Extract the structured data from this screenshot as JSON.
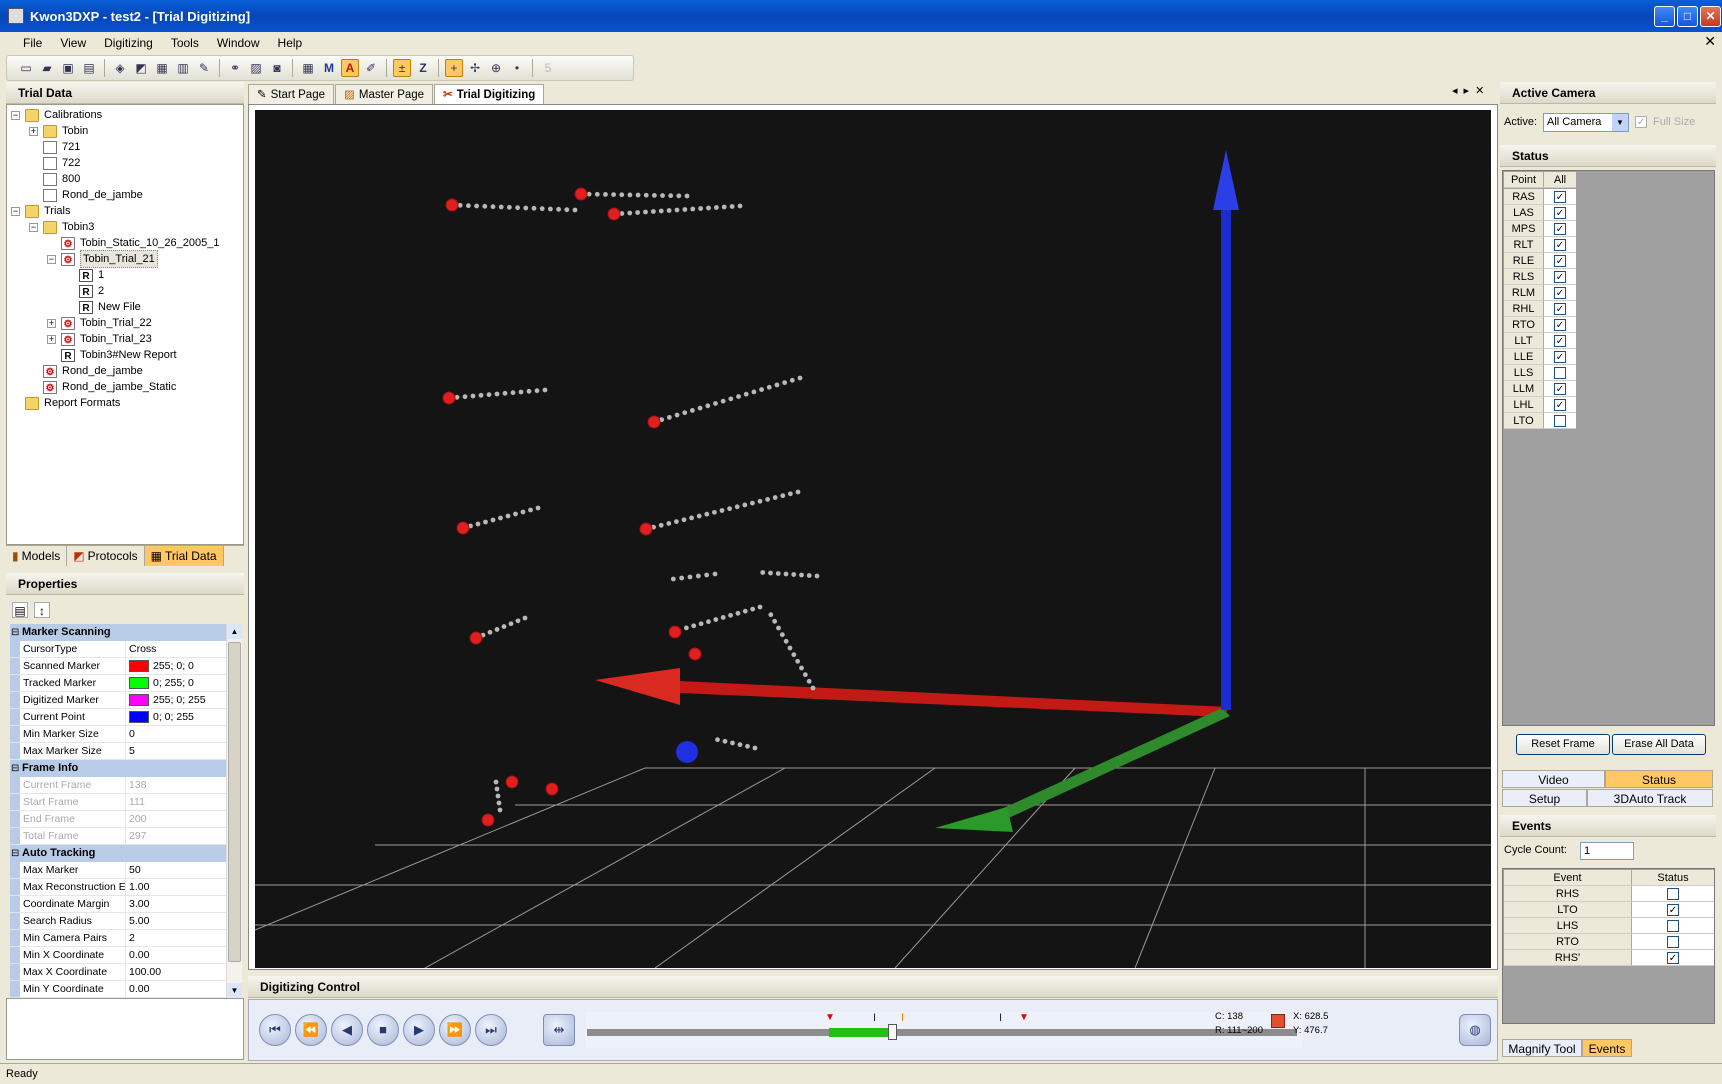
{
  "window": {
    "title": "Kwon3DXP - test2 - [Trial Digitizing]",
    "min": "_",
    "max": "□",
    "close": "✕",
    "mdi_close": "✕"
  },
  "menu": [
    "File",
    "View",
    "Digitizing",
    "Tools",
    "Window",
    "Help"
  ],
  "trial_panel": {
    "title": "Trial Data",
    "tree": [
      {
        "label": "Calibrations",
        "icon": "folder",
        "depth": 0,
        "exp": "−"
      },
      {
        "label": "Tobin",
        "icon": "folder",
        "depth": 1,
        "exp": "+"
      },
      {
        "label": "721",
        "icon": "file",
        "depth": 1
      },
      {
        "label": "722",
        "icon": "file",
        "depth": 1
      },
      {
        "label": "800",
        "icon": "file",
        "depth": 1
      },
      {
        "label": "Rond_de_jambe",
        "icon": "file",
        "depth": 1
      },
      {
        "label": "Trials",
        "icon": "folder",
        "depth": 0,
        "exp": "−"
      },
      {
        "label": "Tobin3",
        "icon": "folder",
        "depth": 1,
        "exp": "−"
      },
      {
        "label": "Tobin_Static_10_26_2005_1",
        "icon": "trial",
        "depth": 2
      },
      {
        "label": "Tobin_Trial_21",
        "icon": "trial",
        "depth": 2,
        "exp": "−",
        "selected": true
      },
      {
        "label": "1",
        "icon": "report",
        "depth": 3
      },
      {
        "label": "2",
        "icon": "report",
        "depth": 3
      },
      {
        "label": "New File",
        "icon": "report",
        "depth": 3
      },
      {
        "label": "Tobin_Trial_22",
        "icon": "trial",
        "depth": 2,
        "exp": "+"
      },
      {
        "label": "Tobin_Trial_23",
        "icon": "trial",
        "depth": 2,
        "exp": "+"
      },
      {
        "label": "Tobin3#New Report",
        "icon": "report",
        "depth": 2
      },
      {
        "label": "Rond_de_jambe",
        "icon": "trial",
        "depth": 1
      },
      {
        "label": "Rond_de_jambe_Static",
        "icon": "trial",
        "depth": 1
      },
      {
        "label": "Report Formats",
        "icon": "folder",
        "depth": 0
      }
    ]
  },
  "left_tabs": [
    "Models",
    "Protocols",
    "Trial Data"
  ],
  "properties": {
    "title": "Properties",
    "categories": [
      {
        "name": "Marker Scanning",
        "rows": [
          {
            "name": "CursorType",
            "value": "Cross"
          },
          {
            "name": "Scanned Marker",
            "value": "255; 0; 0",
            "color": "#ff0000"
          },
          {
            "name": "Tracked Marker",
            "value": "0; 255; 0",
            "color": "#00ff00"
          },
          {
            "name": "Digitized Marker",
            "value": "255; 0; 255",
            "color": "#ff00ff"
          },
          {
            "name": "Current Point",
            "value": "0; 0; 255",
            "color": "#0000ff"
          },
          {
            "name": "Min Marker Size",
            "value": "0"
          },
          {
            "name": "Max Marker Size",
            "value": "5"
          }
        ]
      },
      {
        "name": "Frame Info",
        "rows": [
          {
            "name": "Current Frame",
            "value": "138",
            "dim": true
          },
          {
            "name": "Start Frame",
            "value": "111",
            "dim": true
          },
          {
            "name": "End Frame",
            "value": "200",
            "dim": true
          },
          {
            "name": "Total Frame",
            "value": "297",
            "dim": true
          }
        ]
      },
      {
        "name": "Auto Tracking",
        "rows": [
          {
            "name": "Max Marker",
            "value": "50"
          },
          {
            "name": "Max Reconstruction E",
            "value": "1.00"
          },
          {
            "name": "Coordinate Margin",
            "value": "3.00"
          },
          {
            "name": "Search Radius",
            "value": "5.00"
          },
          {
            "name": "Min Camera Pairs",
            "value": "2"
          },
          {
            "name": "Min X Coordinate",
            "value": "0.00"
          },
          {
            "name": "Max X Coordinate",
            "value": "100.00"
          },
          {
            "name": "Min Y Coordinate",
            "value": "0.00"
          }
        ]
      }
    ]
  },
  "doc_tabs": [
    {
      "label": "Start Page",
      "active": false
    },
    {
      "label": "Master Page",
      "active": false
    },
    {
      "label": "Trial Digitizing",
      "active": true
    }
  ],
  "digitizing_control": {
    "title": "Digitizing Control",
    "readout": {
      "c": "C: 138",
      "r": "R: 111~200",
      "x": "X: 628.5",
      "y": "Y: 476.7"
    }
  },
  "active_camera": {
    "title": "Active Camera",
    "label": "Active:",
    "value": "All Camera",
    "full_size": "Full Size"
  },
  "status": {
    "title": "Status",
    "headers": [
      "Point",
      "All"
    ],
    "points": [
      {
        "name": "RAS",
        "checked": true
      },
      {
        "name": "LAS",
        "checked": true
      },
      {
        "name": "MPS",
        "checked": true
      },
      {
        "name": "RLT",
        "checked": true
      },
      {
        "name": "RLE",
        "checked": true
      },
      {
        "name": "RLS",
        "checked": true
      },
      {
        "name": "RLM",
        "checked": true
      },
      {
        "name": "RHL",
        "checked": true
      },
      {
        "name": "RTO",
        "checked": true
      },
      {
        "name": "LLT",
        "checked": true
      },
      {
        "name": "LLE",
        "checked": true
      },
      {
        "name": "LLS",
        "checked": false
      },
      {
        "name": "LLM",
        "checked": true
      },
      {
        "name": "LHL",
        "checked": true
      },
      {
        "name": "LTO",
        "checked": false
      }
    ],
    "reset_frame": "Reset Frame",
    "erase_all": "Erase All Data"
  },
  "right_tabs_row1": [
    "Video",
    "Status"
  ],
  "right_tabs_row2": [
    "Setup",
    "3DAuto Track"
  ],
  "events": {
    "title": "Events",
    "cycle_label": "Cycle Count:",
    "cycle_value": "1",
    "headers": [
      "Event",
      "Status"
    ],
    "rows": [
      {
        "name": "RHS",
        "checked": false
      },
      {
        "name": "LTO",
        "checked": true
      },
      {
        "name": "LHS",
        "checked": false
      },
      {
        "name": "RTO",
        "checked": false
      },
      {
        "name": "RHS'",
        "checked": true
      }
    ]
  },
  "right_bottom_tabs": [
    "Magnify Tool",
    "Events"
  ],
  "statusbar": "Ready"
}
